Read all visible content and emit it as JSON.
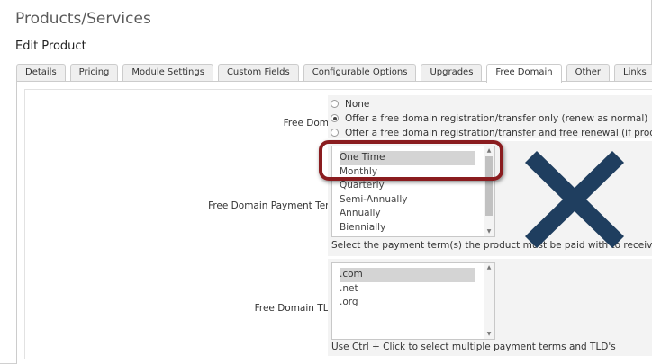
{
  "page": {
    "title": "Products/Services",
    "section": "Edit Product"
  },
  "tabs": [
    {
      "label": "Details",
      "active": false
    },
    {
      "label": "Pricing",
      "active": false
    },
    {
      "label": "Module Settings",
      "active": false
    },
    {
      "label": "Custom Fields",
      "active": false
    },
    {
      "label": "Configurable Options",
      "active": false
    },
    {
      "label": "Upgrades",
      "active": false
    },
    {
      "label": "Free Domain",
      "active": true
    },
    {
      "label": "Other",
      "active": false
    },
    {
      "label": "Links",
      "active": false
    }
  ],
  "free_domain": {
    "label": "Free Domain",
    "options": [
      {
        "label": "None",
        "checked": false
      },
      {
        "label": "Offer a free domain registration/transfer only (renew as normal)",
        "checked": true
      },
      {
        "label": "Offer a free domain registration/transfer and free renewal (if prod",
        "checked": false
      }
    ]
  },
  "payment_terms": {
    "label": "Free Domain Payment Terms",
    "options": [
      "One Time",
      "Monthly",
      "Quarterly",
      "Semi-Annually",
      "Annually",
      "Biennially"
    ],
    "selected": "One Time",
    "help": "Select the payment term(s) the product must be paid with to receive a"
  },
  "tlds": {
    "label": "Free Domain TLD's",
    "options": [
      ".com",
      ".net",
      ".org"
    ],
    "selected": ".com",
    "help": "Use Ctrl + Click to select multiple payment terms and TLD's"
  },
  "annotation": {
    "highlight_color": "#8a1c1f",
    "x_icon": "close-x-icon",
    "x_color": "#1f3e5f"
  }
}
